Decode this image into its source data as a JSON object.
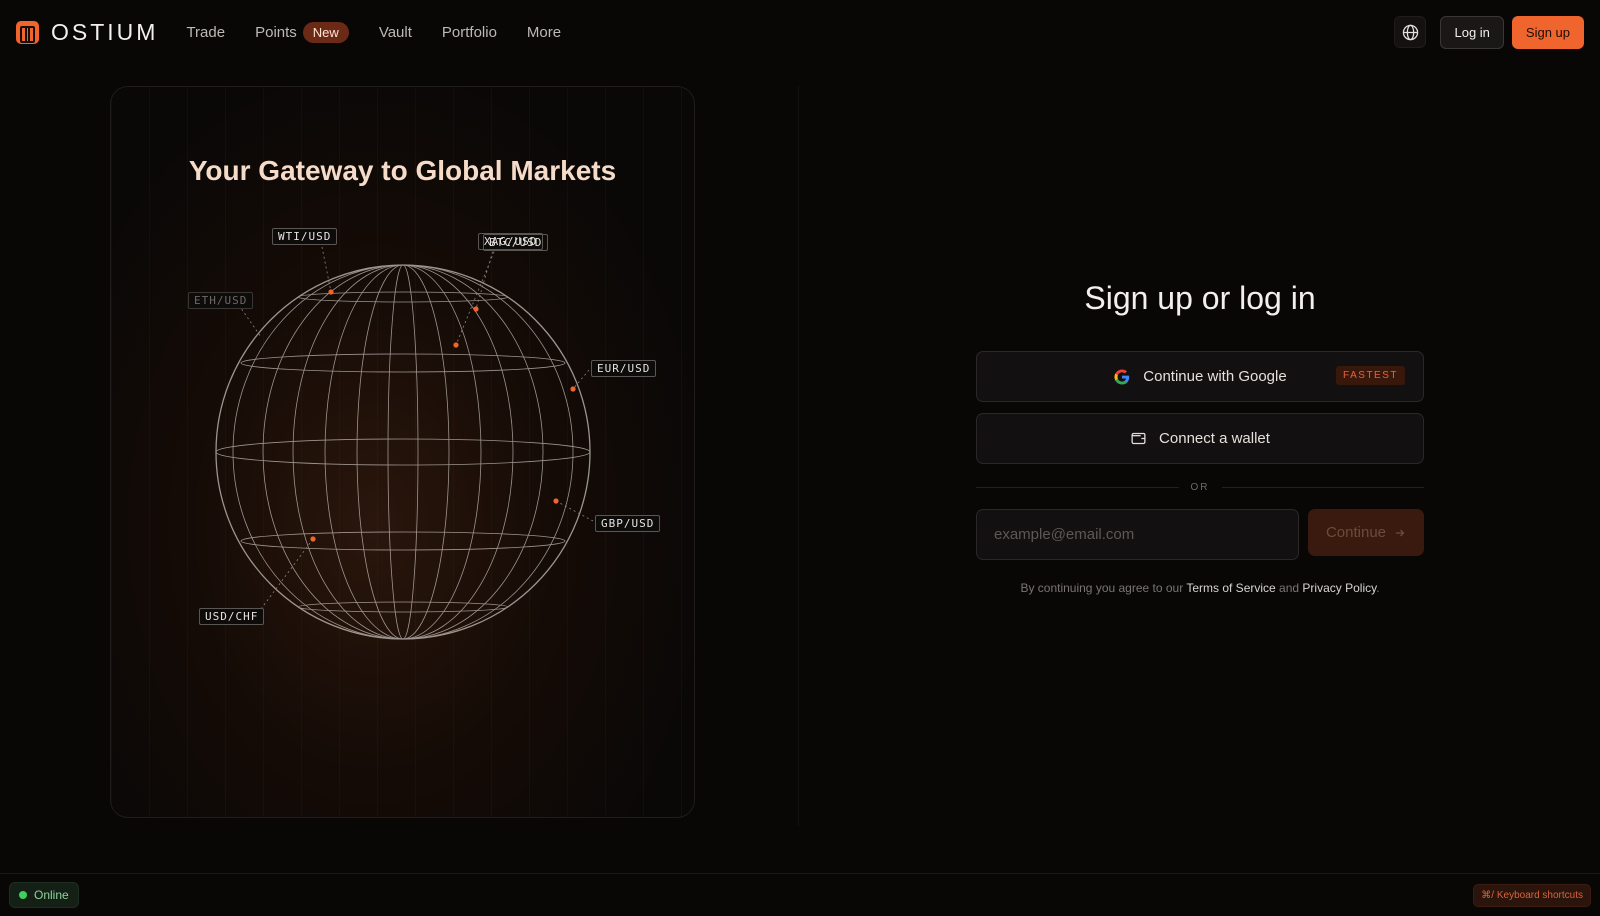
{
  "brand": {
    "name": "OSTIUM"
  },
  "nav": {
    "items": [
      {
        "label": "Trade"
      },
      {
        "label": "Points",
        "badge": "New"
      },
      {
        "label": "Vault"
      },
      {
        "label": "Portfolio"
      },
      {
        "label": "More"
      }
    ]
  },
  "header": {
    "login_label": "Log in",
    "signup_label": "Sign up"
  },
  "promo": {
    "title": "Your Gateway to Global Markets",
    "pairs": [
      "WTI/USD",
      "XAG/USD",
      "BTC/USD",
      "ETH/USD",
      "EUR/USD",
      "GBP/USD",
      "USD/CHF"
    ]
  },
  "auth": {
    "title": "Sign up or log in",
    "google_label": "Continue with Google",
    "google_badge": "FASTEST",
    "wallet_label": "Connect a wallet",
    "or_text": "OR",
    "email_placeholder": "example@email.com",
    "continue_label": "Continue",
    "legal_prefix": "By continuing you agree to our",
    "terms_label": "Terms of Service",
    "legal_and": "and",
    "privacy_label": "Privacy Policy",
    "legal_suffix": "."
  },
  "footer": {
    "status": "Online",
    "shortcuts": "⌘/ Keyboard shortcuts"
  },
  "colors": {
    "accent": "#f0642e",
    "online": "#3bd15a",
    "background": "#080706"
  }
}
